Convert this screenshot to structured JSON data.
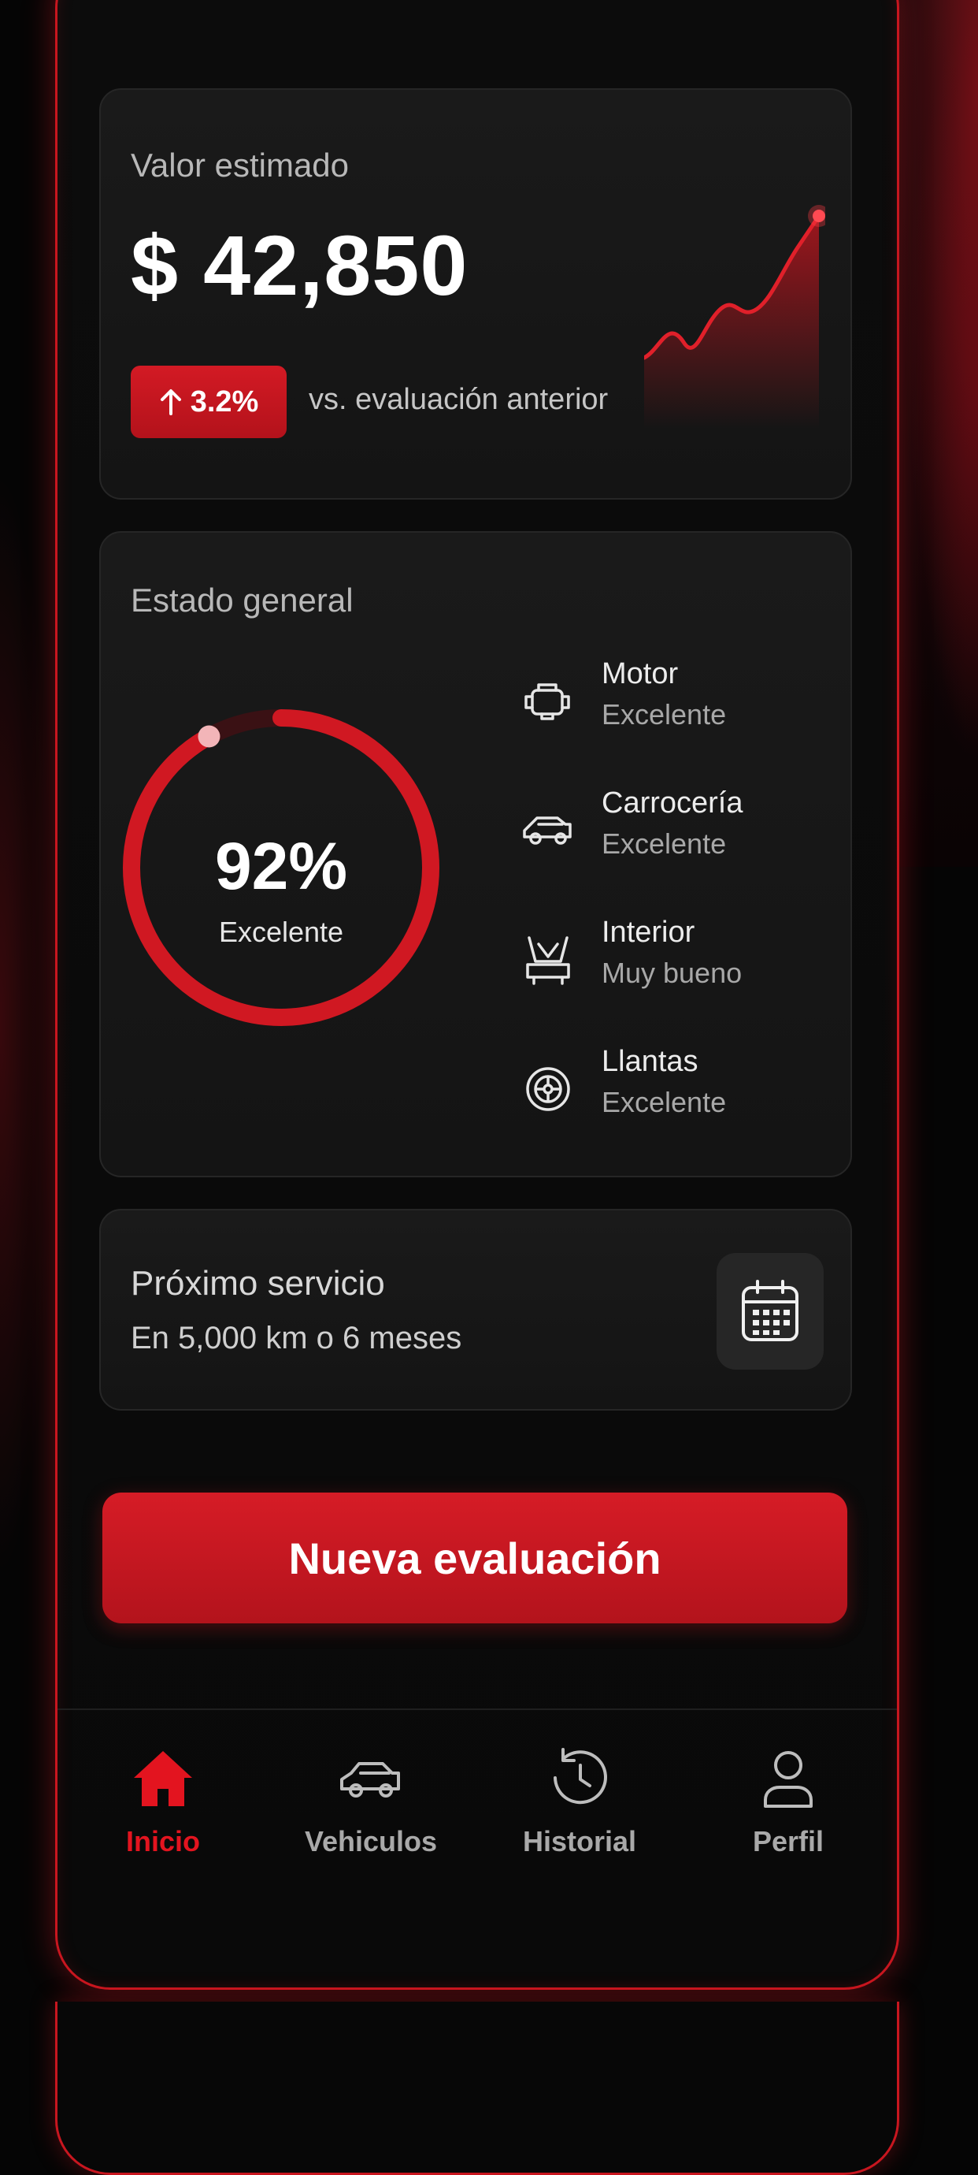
{
  "valuation": {
    "label": "Valor estimado",
    "amount": "$ 42,850",
    "change": "3.2%",
    "change_direction": "up",
    "comparison": "vs. evaluación anterior",
    "accent_color": "#d31a24"
  },
  "condition": {
    "label": "Estado general",
    "score": "92%",
    "score_fraction": 0.92,
    "rating": "Excelente",
    "items": [
      {
        "icon": "engine-icon",
        "name": "Motor",
        "status": "Excelente"
      },
      {
        "icon": "car-body-icon",
        "name": "Carrocería",
        "status": "Excelente"
      },
      {
        "icon": "seat-icon",
        "name": "Interior",
        "status": "Muy bueno"
      },
      {
        "icon": "tire-icon",
        "name": "Llantas",
        "status": "Excelente"
      }
    ]
  },
  "service": {
    "title": "Próximo servicio",
    "detail": "En 5,000 km o 6 meses",
    "icon": "calendar-icon"
  },
  "primary_action": {
    "label": "Nueva evaluación"
  },
  "tabs": [
    {
      "icon": "home-icon",
      "label": "Inicio",
      "active": true
    },
    {
      "icon": "car-icon",
      "label": "Vehiculos",
      "active": false
    },
    {
      "icon": "history-icon",
      "label": "Historial",
      "active": false
    },
    {
      "icon": "user-icon",
      "label": "Perfil",
      "active": false
    }
  ]
}
